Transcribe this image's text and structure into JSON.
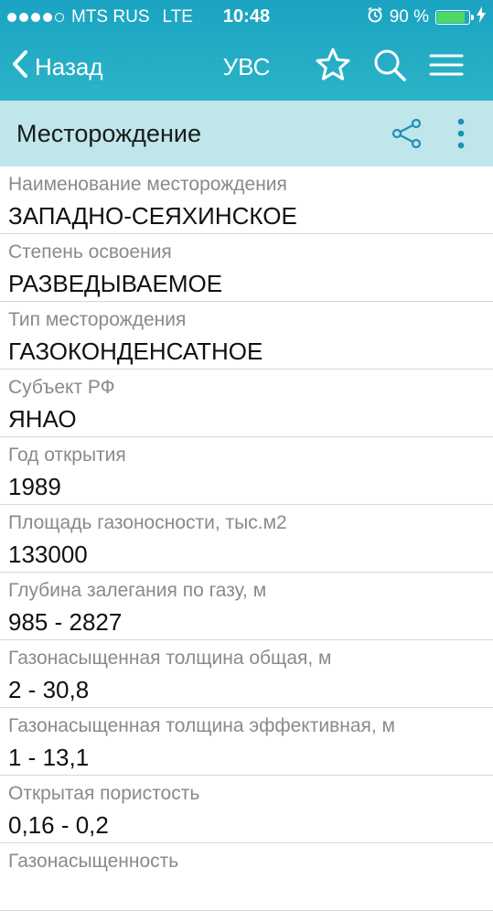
{
  "status_bar": {
    "carrier": "MTS RUS",
    "network": "LTE",
    "time": "10:48",
    "battery": "90 %",
    "battery_level": 0.9
  },
  "navbar": {
    "back_label": "Назад",
    "title": "УВС"
  },
  "section": {
    "title": "Месторождение"
  },
  "fields": [
    {
      "label": "Наименование месторождения",
      "value": "ЗАПАДНО-СЕЯХИНСКОЕ"
    },
    {
      "label": "Степень освоения",
      "value": "РАЗВЕДЫВАЕМОЕ"
    },
    {
      "label": "Тип месторождения",
      "value": "ГАЗОКОНДЕНСАТНОЕ"
    },
    {
      "label": "Субъект РФ",
      "value": "ЯНАО"
    },
    {
      "label": "Год открытия",
      "value": "1989"
    },
    {
      "label": "Площадь газоносности, тыс.м2",
      "value": "133000"
    },
    {
      "label": "Глубина залегания по газу, м",
      "value": "985 - 2827"
    },
    {
      "label": "Газонасыщенная толщина общая, м",
      "value": "2 - 30,8"
    },
    {
      "label": "Газонасыщенная толщина эффективная, м",
      "value": "1 - 13,1"
    },
    {
      "label": "Открытая пористость",
      "value": "0,16 - 0,2"
    },
    {
      "label": "Газонасыщенность",
      "value": ""
    }
  ],
  "colors": {
    "header": "#1aa3c2",
    "subheader": "#bfe6ea",
    "accent": "#1e8fb5",
    "battery": "#4cd964"
  }
}
